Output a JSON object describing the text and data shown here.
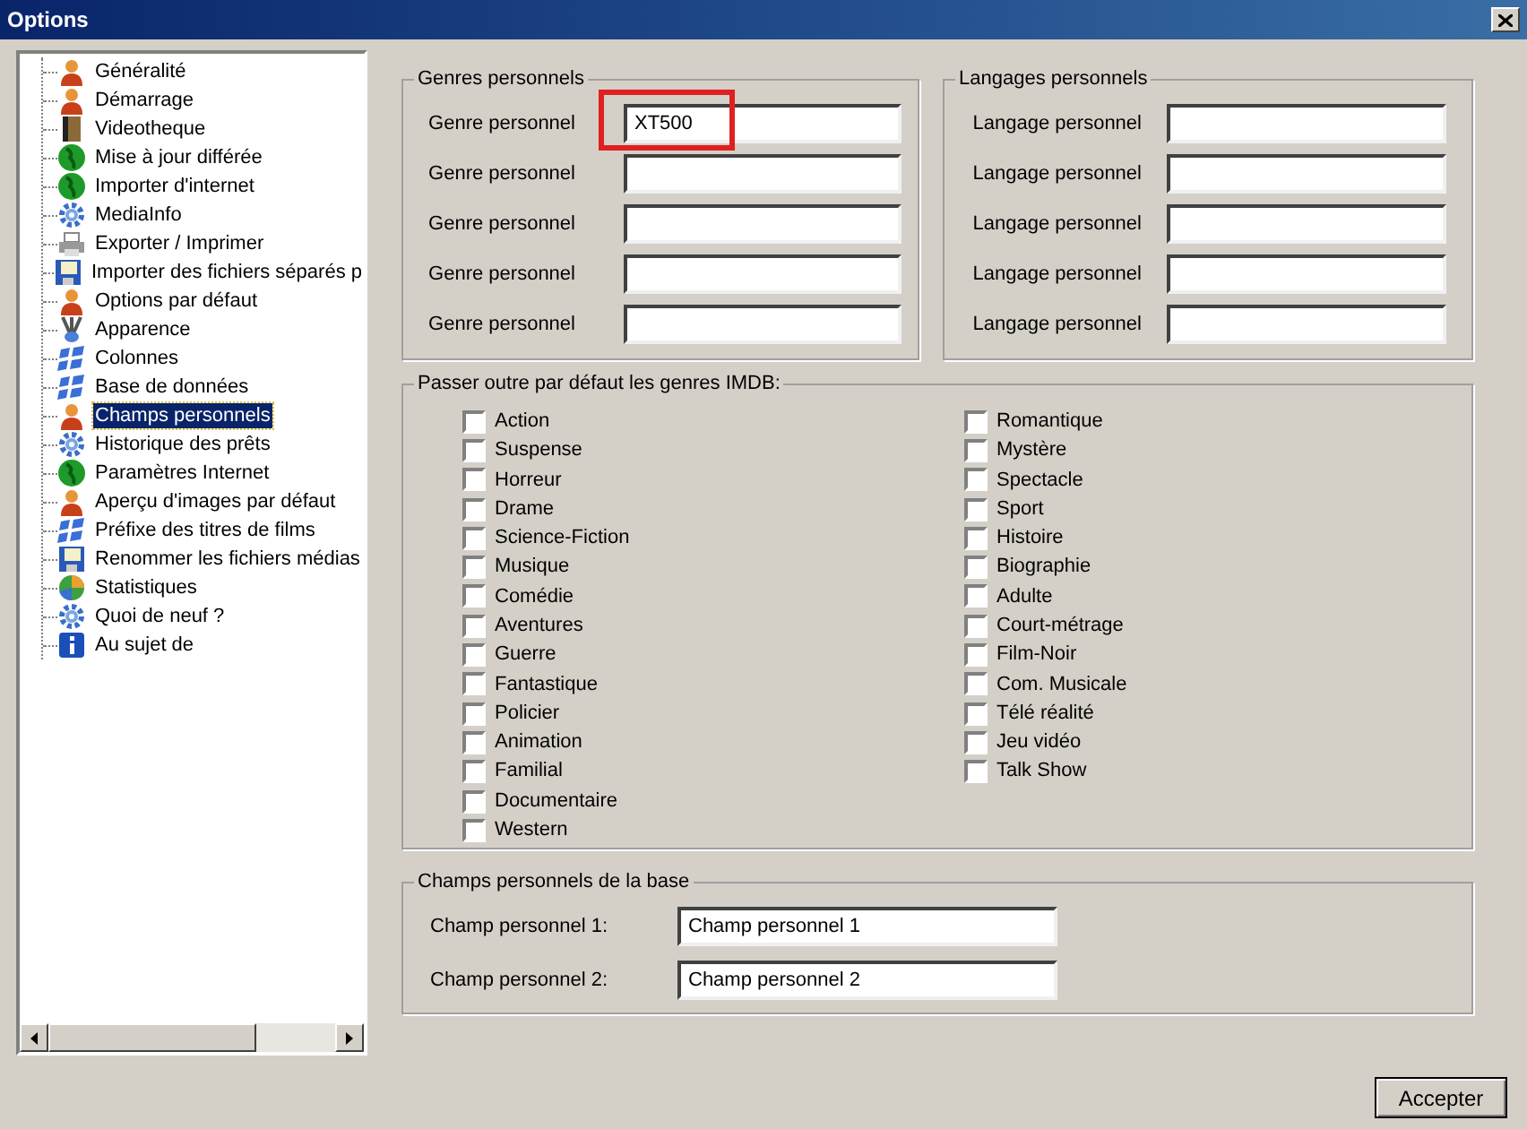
{
  "window": {
    "title": "Options"
  },
  "sidebar": {
    "items": [
      {
        "label": "Généralité",
        "selected": false
      },
      {
        "label": "Démarrage",
        "selected": false
      },
      {
        "label": "Videotheque",
        "selected": false
      },
      {
        "label": "Mise à jour différée",
        "selected": false
      },
      {
        "label": "Importer d'internet",
        "selected": false
      },
      {
        "label": "MediaInfo",
        "selected": false
      },
      {
        "label": "Exporter / Imprimer",
        "selected": false
      },
      {
        "label": "Importer des fichiers séparés p",
        "selected": false
      },
      {
        "label": "Options par défaut",
        "selected": false
      },
      {
        "label": "Apparence",
        "selected": false
      },
      {
        "label": "Colonnes",
        "selected": false
      },
      {
        "label": "Base de données",
        "selected": false
      },
      {
        "label": "Champs personnels",
        "selected": true
      },
      {
        "label": "Historique des prêts",
        "selected": false
      },
      {
        "label": "Paramètres Internet",
        "selected": false
      },
      {
        "label": "Aperçu d'images par défaut",
        "selected": false
      },
      {
        "label": "Préfixe des titres de films",
        "selected": false
      },
      {
        "label": "Renommer les fichiers médias",
        "selected": false
      },
      {
        "label": "Statistiques",
        "selected": false
      },
      {
        "label": "Quoi de neuf ?",
        "selected": false
      },
      {
        "label": "Au sujet de",
        "selected": false
      }
    ]
  },
  "genres": {
    "title": "Genres personnels",
    "fields": [
      {
        "label": "Genre personnel",
        "value": "XT500",
        "highlighted": true
      },
      {
        "label": "Genre personnel",
        "highlighted": false
      },
      {
        "label": "Genre personnel",
        "highlighted": false
      },
      {
        "label": "Genre personnel",
        "highlighted": false
      },
      {
        "label": "Genre personnel",
        "highlighted": false
      }
    ]
  },
  "languages": {
    "title": "Langages personnels",
    "fields": [
      {
        "label": "Langage personnel"
      },
      {
        "label": "Langage personnel"
      },
      {
        "label": "Langage personnel"
      },
      {
        "label": "Langage personnel"
      },
      {
        "label": "Langage personnel"
      }
    ]
  },
  "imdb_override": {
    "title": "Passer outre par défaut les genres IMDB:",
    "columns": [
      [
        {
          "label": "Action",
          "checked": false
        },
        {
          "label": "Suspense",
          "checked": false
        },
        {
          "label": "Horreur",
          "checked": false
        },
        {
          "label": "Drame",
          "checked": false
        },
        {
          "label": "Science-Fiction",
          "checked": false
        },
        {
          "label": "Musique",
          "checked": false
        },
        {
          "label": "Comédie",
          "checked": false
        },
        {
          "label": "Aventures",
          "checked": false
        },
        {
          "label": "Guerre",
          "checked": false
        },
        {
          "label": "Fantastique",
          "checked": false
        },
        {
          "label": "Policier",
          "checked": false
        },
        {
          "label": "Animation",
          "checked": false
        },
        {
          "label": "Familial",
          "checked": false
        },
        {
          "label": "Documentaire",
          "checked": false
        },
        {
          "label": "Western",
          "checked": false
        }
      ],
      [
        {
          "label": "Romantique",
          "checked": false
        },
        {
          "label": "Mystère",
          "checked": false
        },
        {
          "label": "Spectacle",
          "checked": false
        },
        {
          "label": "Sport",
          "checked": false
        },
        {
          "label": "Histoire",
          "checked": false
        },
        {
          "label": "Biographie",
          "checked": false
        },
        {
          "label": "Adulte",
          "checked": false
        },
        {
          "label": "Court-métrage",
          "checked": false
        },
        {
          "label": "Film-Noir",
          "checked": false
        },
        {
          "label": "Com. Musicale",
          "checked": false
        },
        {
          "label": "Télé réalité",
          "checked": false
        },
        {
          "label": "Jeu vidéo",
          "checked": false
        },
        {
          "label": "Talk Show",
          "checked": false
        }
      ]
    ]
  },
  "base_fields": {
    "title": "Champs personnels de la base",
    "fields": [
      {
        "label": "Champ personnel 1:",
        "value": "Champ personnel 1"
      },
      {
        "label": "Champ personnel 2:",
        "value": "Champ personnel 2"
      }
    ]
  },
  "buttons": [
    "Accepter"
  ]
}
